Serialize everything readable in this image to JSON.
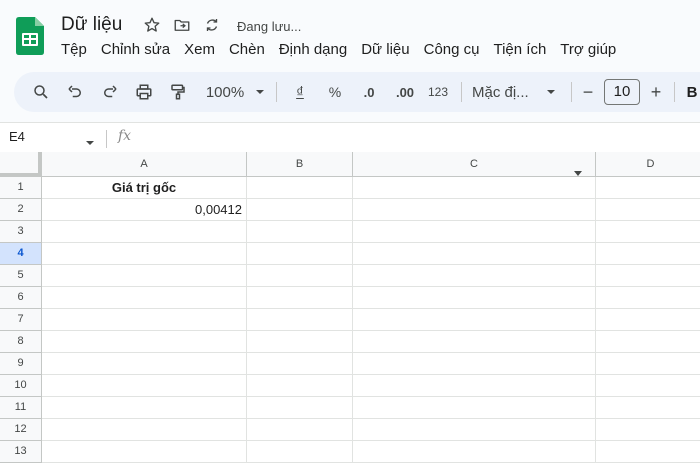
{
  "app": {
    "doc_title": "Dữ liệu",
    "saving_status": "Đang lưu...",
    "logo": "google-sheets-logo"
  },
  "menu": [
    "Tệp",
    "Chỉnh sửa",
    "Xem",
    "Chèn",
    "Định dạng",
    "Dữ liệu",
    "Công cụ",
    "Tiện ích",
    "Trợ giúp"
  ],
  "toolbar": {
    "zoom": "100%",
    "currency": "₫",
    "percent": "%",
    "decrease_decimal": ".0",
    "increase_decimal": ".00",
    "more_formats": "123",
    "font": "Mặc đị...",
    "font_size": "10",
    "minus": "−",
    "plus": "+",
    "bold": "B"
  },
  "formula_bar": {
    "name_box": "E4",
    "fx_label": "fx",
    "formula": ""
  },
  "sheet": {
    "columns": [
      "A",
      "B",
      "C",
      "D"
    ],
    "rows": [
      "1",
      "2",
      "3",
      "4",
      "5",
      "6",
      "7",
      "8",
      "9",
      "10",
      "11",
      "12",
      "13"
    ],
    "active_row": "4",
    "cells": {
      "A1": "Giá trị gốc",
      "A2": "0,00412"
    }
  },
  "colors": {
    "accent": "#0b57d0",
    "sheets_green": "#0f9d58",
    "toolbar_bg": "#edf2fa"
  }
}
